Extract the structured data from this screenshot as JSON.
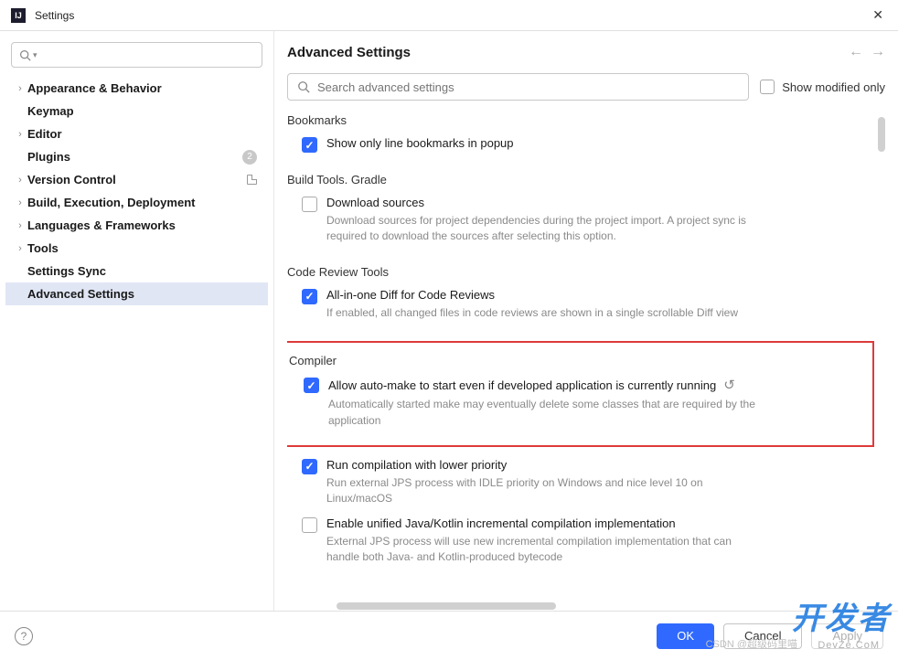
{
  "window": {
    "title": "Settings"
  },
  "sidebar": {
    "items": [
      {
        "label": "Appearance & Behavior",
        "expandable": true
      },
      {
        "label": "Keymap",
        "expandable": false
      },
      {
        "label": "Editor",
        "expandable": true
      },
      {
        "label": "Plugins",
        "expandable": false,
        "badge": "2"
      },
      {
        "label": "Version Control",
        "expandable": true,
        "project": true
      },
      {
        "label": "Build, Execution, Deployment",
        "expandable": true
      },
      {
        "label": "Languages & Frameworks",
        "expandable": true
      },
      {
        "label": "Tools",
        "expandable": true
      },
      {
        "label": "Settings Sync",
        "expandable": false
      },
      {
        "label": "Advanced Settings",
        "expandable": false,
        "selected": true
      }
    ]
  },
  "content": {
    "heading": "Advanced Settings",
    "search_placeholder": "Search advanced settings",
    "modified_only_label": "Show modified only",
    "sections": {
      "bookmarks": {
        "title": "Bookmarks",
        "opt1": {
          "label": "Show only line bookmarks in popup",
          "checked": true
        }
      },
      "gradle": {
        "title": "Build Tools. Gradle",
        "opt1": {
          "label": "Download sources",
          "checked": false,
          "desc": "Download sources for project dependencies during the project import. A project sync is required to download the sources after selecting this option."
        }
      },
      "codereview": {
        "title": "Code Review Tools",
        "opt1": {
          "label": "All-in-one Diff for Code Reviews",
          "checked": true,
          "desc": "If enabled, all changed files in code reviews are shown in a single scrollable Diff view"
        }
      },
      "compiler": {
        "title": "Compiler",
        "opt1": {
          "label": "Allow auto-make to start even if developed application is currently running",
          "checked": true,
          "desc": "Automatically started make may eventually delete some classes that are required by the application"
        },
        "opt2": {
          "label": "Run compilation with lower priority",
          "checked": true,
          "desc": "Run external JPS process with IDLE priority on Windows and nice level 10 on Linux/macOS"
        },
        "opt3": {
          "label": "Enable unified Java/Kotlin incremental compilation implementation",
          "checked": false,
          "desc": "External JPS process will use new incremental compilation implementation that can handle both Java- and Kotlin-produced bytecode"
        }
      }
    }
  },
  "footer": {
    "ok": "OK",
    "cancel": "Cancel",
    "apply": "Apply"
  },
  "watermark": {
    "main_a": "开发者",
    "sub": "DevZe.CoM",
    "csdn": "CSDN @超级码里喵"
  }
}
